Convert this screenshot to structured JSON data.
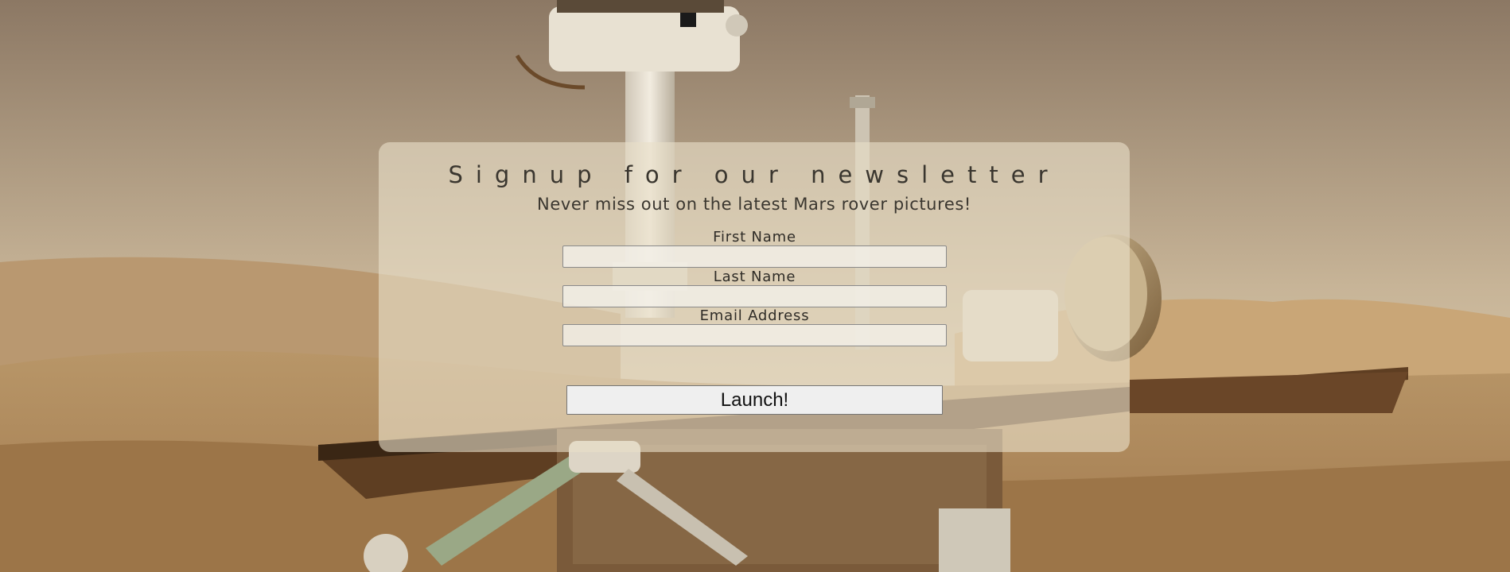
{
  "newsletter": {
    "title": "Signup for our newsletter",
    "subtitle": "Never miss out on the latest Mars rover pictures!",
    "fields": {
      "first_name": {
        "label": "First Name",
        "value": "",
        "placeholder": ""
      },
      "last_name": {
        "label": "Last Name",
        "value": "",
        "placeholder": ""
      },
      "email": {
        "label": "Email Address",
        "value": "",
        "placeholder": ""
      }
    },
    "submit_label": "Launch!"
  },
  "colors": {
    "sky_top": "#8c7864",
    "sky_bottom": "#e6d8bd",
    "ground": "#c29a6a",
    "panel": "#e8dec8",
    "text": "#3a362f"
  }
}
